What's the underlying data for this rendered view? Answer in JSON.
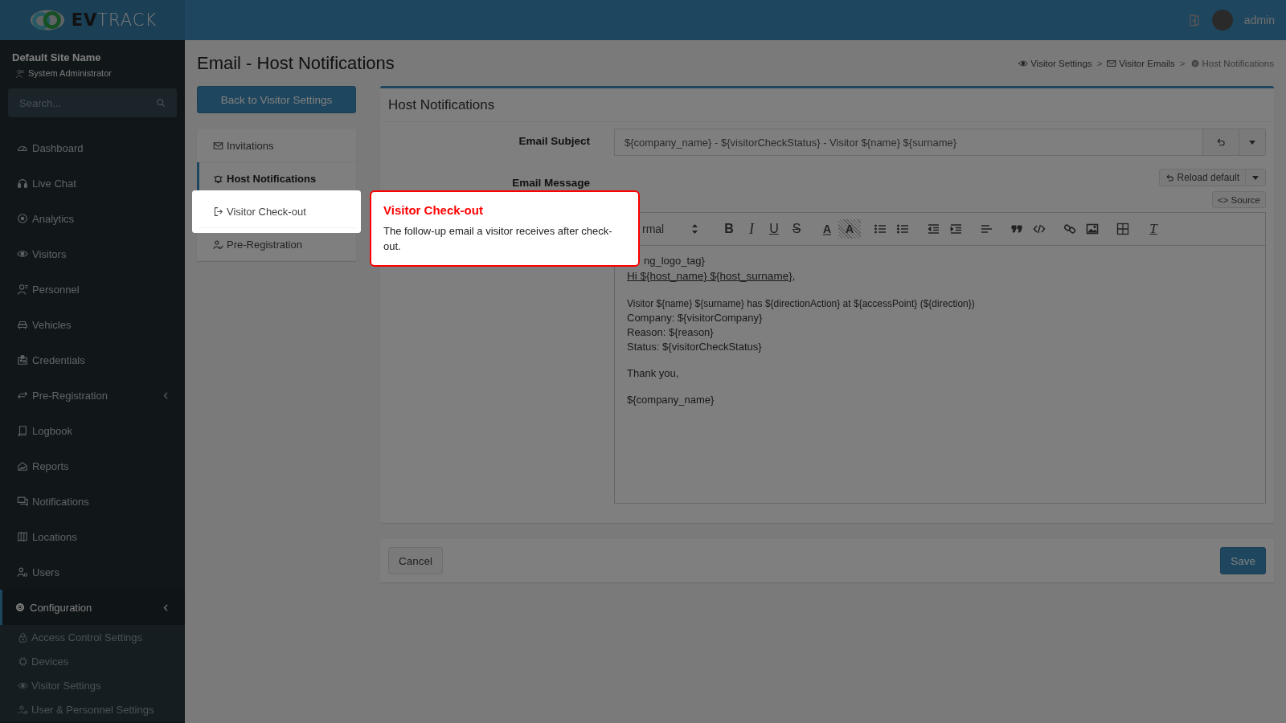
{
  "brand": {
    "logo": "**EV**TRACK"
  },
  "topbar": {
    "user": "admin"
  },
  "sidebar": {
    "site": "Default Site Name",
    "role": "System Administrator",
    "search": {
      "placeholder": "Search..."
    },
    "items": [
      {
        "label": "Dashboard",
        "selected": false,
        "expandable": false
      },
      {
        "label": "Live Chat",
        "selected": false,
        "expandable": false
      },
      {
        "label": "Analytics",
        "selected": false,
        "expandable": false
      },
      {
        "label": "Visitors",
        "selected": false,
        "expandable": false
      },
      {
        "label": "Personnel",
        "selected": false,
        "expandable": false
      },
      {
        "label": "Vehicles",
        "selected": false,
        "expandable": false
      },
      {
        "label": "Credentials",
        "selected": false,
        "expandable": false
      },
      {
        "label": "Pre-Registration",
        "selected": false,
        "expandable": true
      },
      {
        "label": "Logbook",
        "selected": false,
        "expandable": false
      },
      {
        "label": "Reports",
        "selected": false,
        "expandable": false
      },
      {
        "label": "Notifications",
        "selected": false,
        "expandable": false
      },
      {
        "label": "Locations",
        "selected": false,
        "expandable": false
      },
      {
        "label": "Users",
        "selected": false,
        "expandable": false
      },
      {
        "label": "Configuration",
        "selected": true,
        "expandable": true,
        "children": [
          {
            "label": "Access Control Settings"
          },
          {
            "label": "Devices"
          },
          {
            "label": "Visitor Settings"
          },
          {
            "label": "User & Personnel Settings"
          }
        ]
      }
    ]
  },
  "page": {
    "title": "Email - Host Notifications",
    "breadcrumb": [
      "Visitor Settings",
      "Visitor Emails",
      "Host Notifications"
    ],
    "breadcrumb_separators": [
      ">",
      ">"
    ]
  },
  "back_button": "Back to Visitor Settings",
  "template_tabs": [
    {
      "label": "Invitations",
      "selected": false,
      "highlighted": false
    },
    {
      "label": "Host Notifications",
      "selected": true,
      "highlighted": false
    },
    {
      "label": "Visitor Check-out",
      "selected": false,
      "highlighted": true
    },
    {
      "label": "Pre-Registration",
      "selected": false,
      "highlighted": false
    }
  ],
  "tour_tip": {
    "title": "Visitor Check-out",
    "text": "The follow-up email a visitor receives after check-out."
  },
  "panel": {
    "title": "Host Notifications",
    "subject": {
      "label": "Email Subject",
      "value": "${company_name} - ${visitorCheckStatus} - Visitor ${name} ${surname}"
    },
    "message": {
      "label": "Email Message",
      "reload_button": "Reload default",
      "source_button": "<> Source",
      "toolbar": [
        {
          "kind": "select",
          "text": "rmal"
        },
        {
          "kind": "bold",
          "text": "B"
        },
        {
          "kind": "italic",
          "text": "I"
        },
        {
          "kind": "underline",
          "text": "U"
        },
        {
          "kind": "strike",
          "text": "S"
        },
        {
          "kind": "color",
          "text": "A"
        },
        {
          "kind": "background",
          "text": "A"
        },
        {
          "kind": "ordered"
        },
        {
          "kind": "bullet"
        },
        {
          "kind": "outdent"
        },
        {
          "kind": "indent"
        },
        {
          "kind": "align"
        },
        {
          "kind": "quote"
        },
        {
          "kind": "code"
        },
        {
          "kind": "link"
        },
        {
          "kind": "image"
        },
        {
          "kind": "table"
        },
        {
          "kind": "clean",
          "text": "T"
        }
      ],
      "body": [
        {
          "kind": "partial",
          "text": "ng_logo_tag}"
        },
        {
          "kind": "link",
          "text": "Hi ${host_name} ${host_surname}",
          "after": ","
        },
        {
          "kind": "blank"
        },
        {
          "kind": "small",
          "text": "Visitor ${name} ${surname} has ${directionAction} at ${accessPoint} (${direction})"
        },
        {
          "kind": "text",
          "text": "Company: ${visitorCompany}"
        },
        {
          "kind": "text",
          "text": "Reason: ${reason}"
        },
        {
          "kind": "text",
          "text": "Status: ${visitorCheckStatus}"
        },
        {
          "kind": "blank"
        },
        {
          "kind": "text",
          "text": "Thank you,"
        },
        {
          "kind": "blank"
        },
        {
          "kind": "text",
          "text": "${company_name}"
        }
      ]
    }
  },
  "footer": {
    "cancel": "Cancel",
    "save": "Save"
  }
}
